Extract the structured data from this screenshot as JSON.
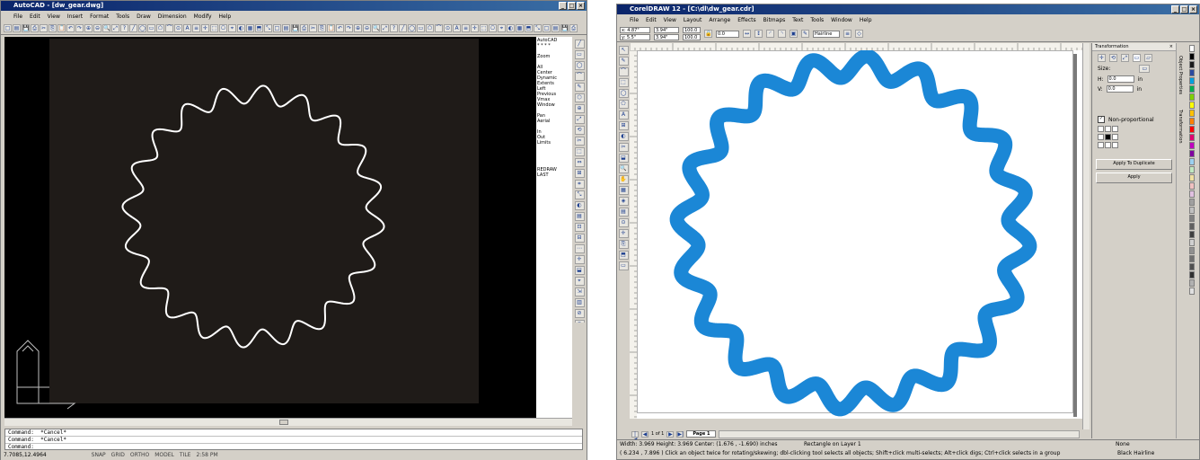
{
  "autocad": {
    "title": "AutoCAD - [dw_gear.dwg]",
    "menu": [
      "File",
      "Edit",
      "View",
      "Insert",
      "Format",
      "Tools",
      "Draw",
      "Dimension",
      "Modify",
      "Help"
    ],
    "side_menu": [
      "AutoCAD",
      "* * * *",
      "",
      "Zoom",
      "",
      "All",
      "Center",
      "Dynamic",
      "Extents",
      "Left",
      "Previous",
      "Vmax",
      "Window",
      "",
      "Pan",
      "Aerial",
      "",
      "In",
      "Out",
      "Limits",
      "",
      "",
      "",
      "",
      "REDRAW",
      "LAST"
    ],
    "command_lines": [
      "Command:  *Cancel*",
      "Command:  *Cancel*",
      "Command:"
    ],
    "status": {
      "coords": "7.7085,12.4964",
      "modes": [
        "SNAP",
        "GRID",
        "ORTHO",
        "MODEL",
        "TILE",
        "2:58 PM"
      ]
    }
  },
  "corel": {
    "title": "CorelDRAW 12 - [C:\\dl\\dw_gear.cdr]",
    "menu": [
      "File",
      "Edit",
      "View",
      "Layout",
      "Arrange",
      "Effects",
      "Bitmaps",
      "Text",
      "Tools",
      "Window",
      "Help"
    ],
    "property_bar": {
      "x": "x: 4.87\"",
      "y": "y: 5.5\"",
      "w": "3.94\"",
      "h": "3.94\"",
      "scale_w": "100.0",
      "scale_h": "100.0",
      "angle": "0.0",
      "outline": "Hairline"
    },
    "docker": {
      "title": "Transformation",
      "size_label": "Size:",
      "h_label": "H:",
      "h_value": "0.0",
      "v_label": "V:",
      "v_value": "0.0",
      "unit": "in",
      "non_proportional": "Non-proportional",
      "apply_duplicate": "Apply To Duplicate",
      "apply": "Apply",
      "side_tabs": [
        "Object Properties",
        "Transformation"
      ]
    },
    "page_nav": {
      "counter": "1 of 1",
      "page_tab": "Page 1"
    },
    "status": {
      "line1": "Width: 3.969  Height: 3.969  Center: (1.676 , -1.690)  inches",
      "line1_right": "Rectangle on Layer 1",
      "line2": "( 6.234 , 7.896 )        Click an object twice for rotating/skewing; dbl-clicking tool selects all objects; Shift+click multi-selects; Alt+click digs; Ctrl+click selects in a group",
      "fill_label": "None",
      "outline_label": "Black  Hairline"
    },
    "palette_colors": [
      "#ffffff",
      "#000000",
      "#1a1a1a",
      "#2b4aa0",
      "#00a0e0",
      "#00b050",
      "#7fd000",
      "#ffff00",
      "#ffc000",
      "#ff8000",
      "#ff0000",
      "#e00070",
      "#c000c0",
      "#8000a0",
      "#9ad0f0",
      "#c0e8c0",
      "#f0e0a0",
      "#f0c0c0",
      "#e0c0e0",
      "#a0a0a0",
      "#c0c0c0",
      "#808080",
      "#606060",
      "#404040",
      "#d0d0d0",
      "#909090",
      "#707070",
      "#505050",
      "#303030",
      "#b0b0b0",
      "#e0e0e0"
    ],
    "gear_color": "#1b87d6"
  },
  "gear": {
    "lobes": 20
  }
}
